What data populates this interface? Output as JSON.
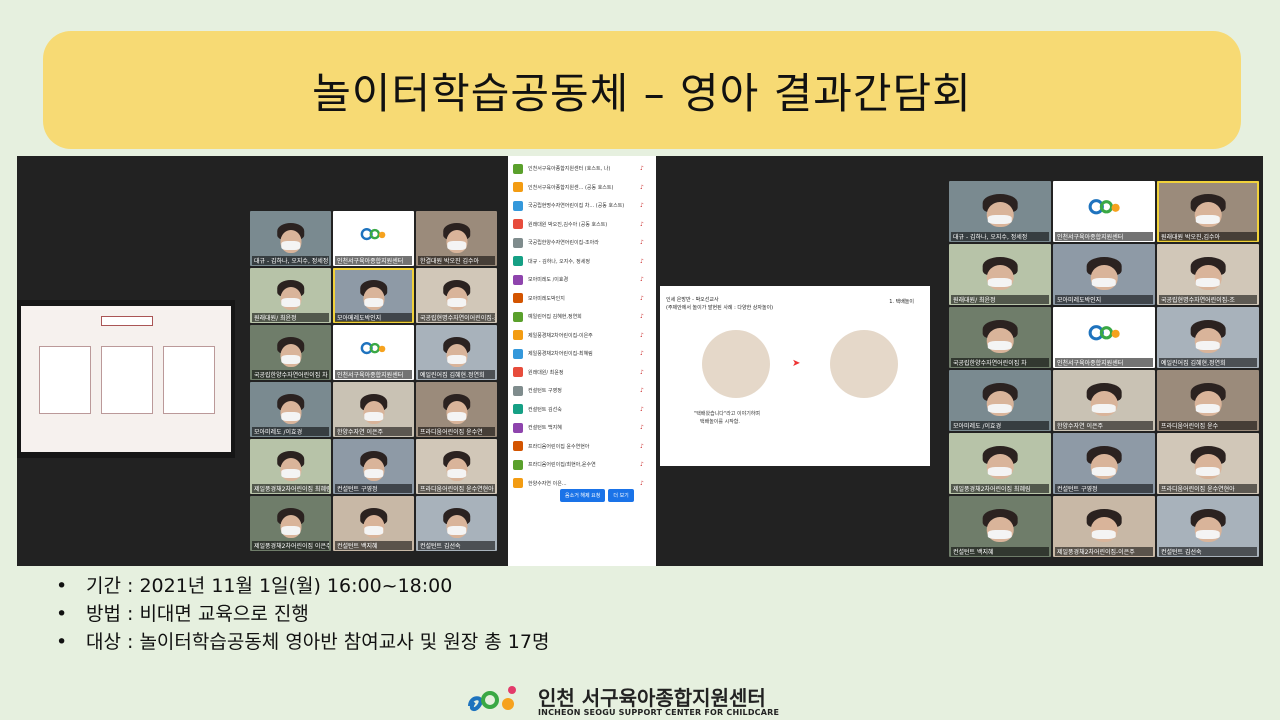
{
  "title": "놀이터학습공동체 – 영아 결과간담회",
  "bullets": [
    "기간 : 2021년 11월 1일(월) 16:00~18:00",
    "방법 : 비대면 교육으로 진행",
    "대상 : 놀이터학습공동체 영아반 참여교사 및 원장 총 17명"
  ],
  "footer": {
    "name_ko": "인천 서구육아종합지원센터",
    "name_en": "INCHEON SEOGU SUPPORT CENTER FOR CHILDCARE"
  },
  "screenshot": {
    "left_slide": {
      "header": "평 가 체"
    },
    "left_grid": [
      "대규 - 김하나, 오지수, 정세정",
      "인천서구육아종합지원센터",
      "한결대원 박오진 김수아",
      "원래대원/ 최윤정",
      "모아메레도박인지",
      "국공립현명수자연이어린이집-조",
      "국공립한양수자연어린이집 차",
      "인천서구육아종합지원센터",
      "예일린어집 김혜현.정연희",
      "모아미레도 /이효경",
      "한양수자연 이은주",
      "프라디움어린이집 윤수연",
      "제일풍경채2차어린이집 최혜림",
      "컨설턴트 구영정",
      "프라디움어린이집 윤수연현아",
      "제일풍경채2차어린이집 이은주",
      "컨설턴트 백지혜",
      "컨설턴트 김선숙"
    ],
    "participants": [
      "인천서구육아종합지원센터 (호스트, 나)",
      "인천서구육아종합지원센... (공동 호스트)",
      "국공립현명수자연어린이집 차... (공동 호스트)",
      "원래대원 박오진,김수아 (공동 호스트)",
      "국공립한양수자연어린이집-조아라",
      "대규 - 김하나, 오지수, 정세정",
      "모아미레도 /이효경",
      "모아미레도박인지",
      "예일린어집 김혜현,정연희",
      "제일풍경채2차어린이집-이은주",
      "제일풍경채2차어린이집-최혜림",
      "원래대원/ 최윤정",
      "컨설턴트 구영정",
      "컨설턴트 김선숙",
      "컨설턴트 백지혜",
      "프라디움어린이집 윤수연현아",
      "프라디움어린이집/최현아,윤수연",
      "한양수자연 이은..."
    ],
    "participant_buttons": [
      "음소거 해제 요청",
      "더 보기"
    ],
    "presentation": {
      "line1": "인세 은방반 - 박오선교사",
      "line2": "(주제안에서 놀이가 발현된 사례 : 다양한 상자놀이)",
      "top_right": "1. 택배놀이",
      "caption1": "\"택배왔습니다\"라고 이야기하며",
      "caption2": "택배놀이를 시작함."
    },
    "right_grid": [
      "대규 - 김하나, 오지수, 정세정",
      "인천서구육아종합지원센터",
      "원래대원 박오진,김수아",
      "원래대원/ 최윤정",
      "모아미레도박인지",
      "국공립현명수자연어린이집-조",
      "국공립한양수자연어린이집 차",
      "인천서구육아종합지원센터",
      "예일린어집 김혜현,정연희",
      "모아미레도 /이효경",
      "한양수자연 이은주",
      "프라디움어린이집 윤수",
      "제일풍경채2차어린이집 최혜림",
      "컨설턴트 구영정",
      "프라디움어린이집 윤수연현아",
      "컨설턴트 백지혜",
      "제일풍경채2차어린이집-이은주",
      "컨설턴트 김선숙"
    ]
  }
}
